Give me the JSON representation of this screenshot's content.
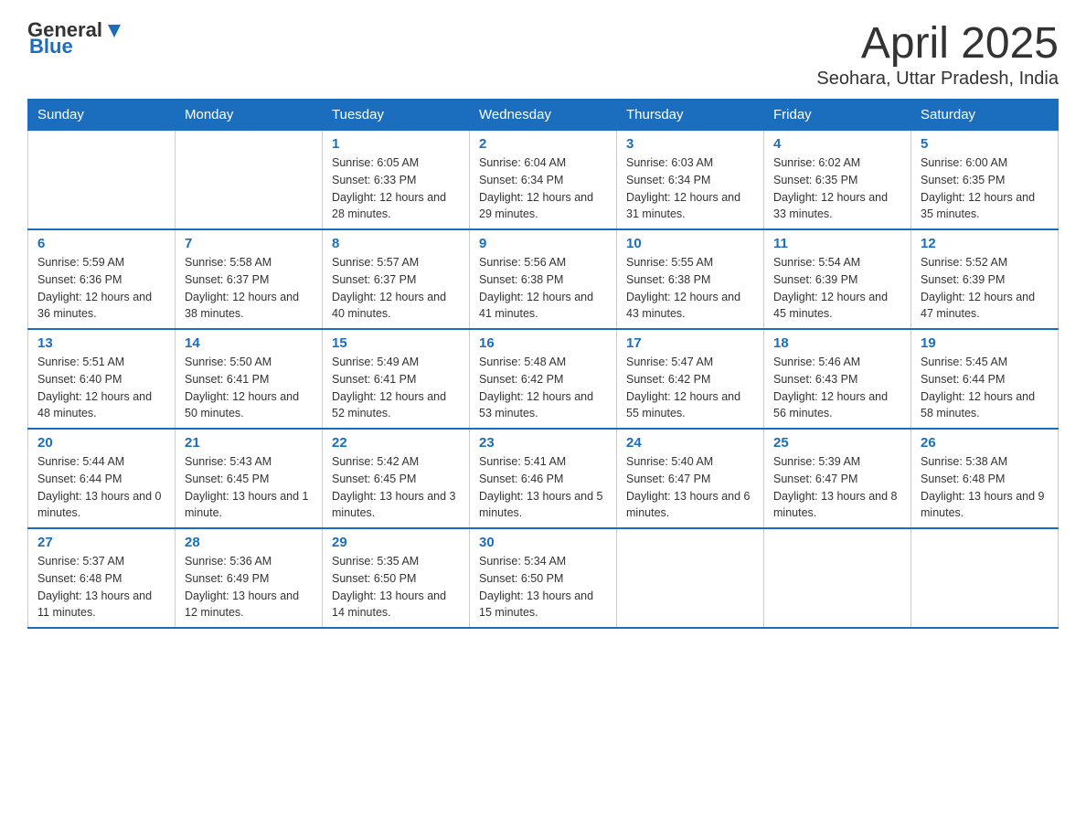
{
  "header": {
    "logo_general": "General",
    "logo_blue": "Blue",
    "title": "April 2025",
    "subtitle": "Seohara, Uttar Pradesh, India"
  },
  "days_of_week": [
    "Sunday",
    "Monday",
    "Tuesday",
    "Wednesday",
    "Thursday",
    "Friday",
    "Saturday"
  ],
  "weeks": [
    [
      {
        "num": "",
        "sunrise": "",
        "sunset": "",
        "daylight": ""
      },
      {
        "num": "",
        "sunrise": "",
        "sunset": "",
        "daylight": ""
      },
      {
        "num": "1",
        "sunrise": "Sunrise: 6:05 AM",
        "sunset": "Sunset: 6:33 PM",
        "daylight": "Daylight: 12 hours and 28 minutes."
      },
      {
        "num": "2",
        "sunrise": "Sunrise: 6:04 AM",
        "sunset": "Sunset: 6:34 PM",
        "daylight": "Daylight: 12 hours and 29 minutes."
      },
      {
        "num": "3",
        "sunrise": "Sunrise: 6:03 AM",
        "sunset": "Sunset: 6:34 PM",
        "daylight": "Daylight: 12 hours and 31 minutes."
      },
      {
        "num": "4",
        "sunrise": "Sunrise: 6:02 AM",
        "sunset": "Sunset: 6:35 PM",
        "daylight": "Daylight: 12 hours and 33 minutes."
      },
      {
        "num": "5",
        "sunrise": "Sunrise: 6:00 AM",
        "sunset": "Sunset: 6:35 PM",
        "daylight": "Daylight: 12 hours and 35 minutes."
      }
    ],
    [
      {
        "num": "6",
        "sunrise": "Sunrise: 5:59 AM",
        "sunset": "Sunset: 6:36 PM",
        "daylight": "Daylight: 12 hours and 36 minutes."
      },
      {
        "num": "7",
        "sunrise": "Sunrise: 5:58 AM",
        "sunset": "Sunset: 6:37 PM",
        "daylight": "Daylight: 12 hours and 38 minutes."
      },
      {
        "num": "8",
        "sunrise": "Sunrise: 5:57 AM",
        "sunset": "Sunset: 6:37 PM",
        "daylight": "Daylight: 12 hours and 40 minutes."
      },
      {
        "num": "9",
        "sunrise": "Sunrise: 5:56 AM",
        "sunset": "Sunset: 6:38 PM",
        "daylight": "Daylight: 12 hours and 41 minutes."
      },
      {
        "num": "10",
        "sunrise": "Sunrise: 5:55 AM",
        "sunset": "Sunset: 6:38 PM",
        "daylight": "Daylight: 12 hours and 43 minutes."
      },
      {
        "num": "11",
        "sunrise": "Sunrise: 5:54 AM",
        "sunset": "Sunset: 6:39 PM",
        "daylight": "Daylight: 12 hours and 45 minutes."
      },
      {
        "num": "12",
        "sunrise": "Sunrise: 5:52 AM",
        "sunset": "Sunset: 6:39 PM",
        "daylight": "Daylight: 12 hours and 47 minutes."
      }
    ],
    [
      {
        "num": "13",
        "sunrise": "Sunrise: 5:51 AM",
        "sunset": "Sunset: 6:40 PM",
        "daylight": "Daylight: 12 hours and 48 minutes."
      },
      {
        "num": "14",
        "sunrise": "Sunrise: 5:50 AM",
        "sunset": "Sunset: 6:41 PM",
        "daylight": "Daylight: 12 hours and 50 minutes."
      },
      {
        "num": "15",
        "sunrise": "Sunrise: 5:49 AM",
        "sunset": "Sunset: 6:41 PM",
        "daylight": "Daylight: 12 hours and 52 minutes."
      },
      {
        "num": "16",
        "sunrise": "Sunrise: 5:48 AM",
        "sunset": "Sunset: 6:42 PM",
        "daylight": "Daylight: 12 hours and 53 minutes."
      },
      {
        "num": "17",
        "sunrise": "Sunrise: 5:47 AM",
        "sunset": "Sunset: 6:42 PM",
        "daylight": "Daylight: 12 hours and 55 minutes."
      },
      {
        "num": "18",
        "sunrise": "Sunrise: 5:46 AM",
        "sunset": "Sunset: 6:43 PM",
        "daylight": "Daylight: 12 hours and 56 minutes."
      },
      {
        "num": "19",
        "sunrise": "Sunrise: 5:45 AM",
        "sunset": "Sunset: 6:44 PM",
        "daylight": "Daylight: 12 hours and 58 minutes."
      }
    ],
    [
      {
        "num": "20",
        "sunrise": "Sunrise: 5:44 AM",
        "sunset": "Sunset: 6:44 PM",
        "daylight": "Daylight: 13 hours and 0 minutes."
      },
      {
        "num": "21",
        "sunrise": "Sunrise: 5:43 AM",
        "sunset": "Sunset: 6:45 PM",
        "daylight": "Daylight: 13 hours and 1 minute."
      },
      {
        "num": "22",
        "sunrise": "Sunrise: 5:42 AM",
        "sunset": "Sunset: 6:45 PM",
        "daylight": "Daylight: 13 hours and 3 minutes."
      },
      {
        "num": "23",
        "sunrise": "Sunrise: 5:41 AM",
        "sunset": "Sunset: 6:46 PM",
        "daylight": "Daylight: 13 hours and 5 minutes."
      },
      {
        "num": "24",
        "sunrise": "Sunrise: 5:40 AM",
        "sunset": "Sunset: 6:47 PM",
        "daylight": "Daylight: 13 hours and 6 minutes."
      },
      {
        "num": "25",
        "sunrise": "Sunrise: 5:39 AM",
        "sunset": "Sunset: 6:47 PM",
        "daylight": "Daylight: 13 hours and 8 minutes."
      },
      {
        "num": "26",
        "sunrise": "Sunrise: 5:38 AM",
        "sunset": "Sunset: 6:48 PM",
        "daylight": "Daylight: 13 hours and 9 minutes."
      }
    ],
    [
      {
        "num": "27",
        "sunrise": "Sunrise: 5:37 AM",
        "sunset": "Sunset: 6:48 PM",
        "daylight": "Daylight: 13 hours and 11 minutes."
      },
      {
        "num": "28",
        "sunrise": "Sunrise: 5:36 AM",
        "sunset": "Sunset: 6:49 PM",
        "daylight": "Daylight: 13 hours and 12 minutes."
      },
      {
        "num": "29",
        "sunrise": "Sunrise: 5:35 AM",
        "sunset": "Sunset: 6:50 PM",
        "daylight": "Daylight: 13 hours and 14 minutes."
      },
      {
        "num": "30",
        "sunrise": "Sunrise: 5:34 AM",
        "sunset": "Sunset: 6:50 PM",
        "daylight": "Daylight: 13 hours and 15 minutes."
      },
      {
        "num": "",
        "sunrise": "",
        "sunset": "",
        "daylight": ""
      },
      {
        "num": "",
        "sunrise": "",
        "sunset": "",
        "daylight": ""
      },
      {
        "num": "",
        "sunrise": "",
        "sunset": "",
        "daylight": ""
      }
    ]
  ]
}
